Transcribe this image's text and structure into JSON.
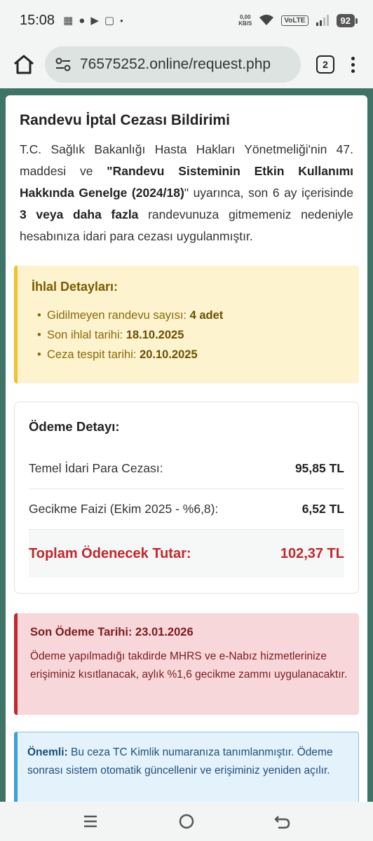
{
  "status_bar": {
    "time": "15:08",
    "net_speed_value": "0,00",
    "net_speed_unit": "KB/S",
    "volte": "VoLTE",
    "battery": "92"
  },
  "browser": {
    "url": "76575252.online/request.php",
    "tab_count": "2"
  },
  "card": {
    "title": "Randevu İptal Cezası Bildirimi",
    "intro": {
      "part1": "T.C. Sağlık Bakanlığı Hasta Hakları Yönetmeliği'nin 47. maddesi ve ",
      "bold1": "\"Randevu Sisteminin Etkin Kullanımı Hakkında Genelge (2024/18)",
      "part2": "\" uyarınca, son 6 ay içerisinde ",
      "bold2": "3 veya daha fazla",
      "part3": " randevunuza gitmemeniz nedeniyle hesabınıza idari para cezası uygulanmıştır."
    },
    "violation": {
      "title": "İhlal Detayları:",
      "items": [
        {
          "label": "Gidilmeyen randevu sayısı: ",
          "value": "4 adet"
        },
        {
          "label": "Son ihlal tarihi: ",
          "value": "18.10.2025"
        },
        {
          "label": "Ceza tespit tarihi: ",
          "value": "20.10.2025"
        }
      ]
    },
    "payment": {
      "title": "Ödeme Detayı:",
      "rows": [
        {
          "label": "Temel İdari Para Cezası:",
          "amount": "95,85 TL"
        },
        {
          "label": "Gecikme Faizi (Ekim 2025 - %6,8):",
          "amount": "6,52 TL"
        }
      ],
      "total_label": "Toplam Ödenecek Tutar:",
      "total_amount": "102,37 TL"
    },
    "deadline": {
      "title": "Son Ödeme Tarihi: 23.01.2026",
      "text": "Ödeme yapılmadığı takdirde MHRS ve e-Nabız hizmetlerinize erişiminiz kısıtlanacak, aylık %1,6 gecikme zammı uygulanacaktır."
    },
    "important": {
      "label": "Önemli:",
      "text": " Bu ceza TC Kimlik numaranıza tanımlanmıştır. Ödeme sonrası sistem otomatik güncellenir ve erişiminiz yeniden açılır."
    }
  },
  "colors": {
    "page_bg": "#3e7466",
    "warning_bg": "#fdf3cf",
    "danger": "#c0282d",
    "info_bg": "#e3f2fb"
  }
}
